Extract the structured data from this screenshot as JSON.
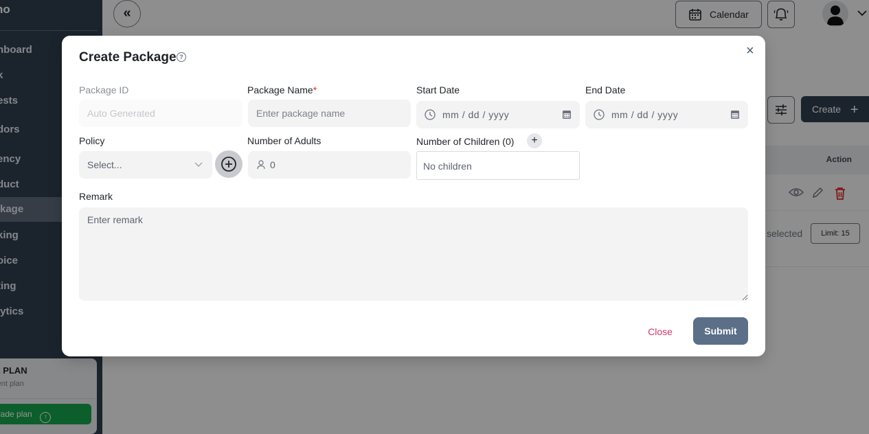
{
  "sidebar": {
    "brand": "no",
    "items": [
      {
        "label": "hboard"
      },
      {
        "label": "k"
      },
      {
        "label": "ests"
      },
      {
        "label": "dors"
      },
      {
        "label": "ency"
      },
      {
        "label": "duct"
      },
      {
        "label": "kage",
        "active": true
      },
      {
        "label": "king"
      },
      {
        "label": "oice"
      },
      {
        "label": "ting"
      },
      {
        "label": "lytics"
      }
    ],
    "plan": {
      "title": "E PLAN",
      "subtitle": "rent plan",
      "upgrade_label": "grade plan"
    }
  },
  "topbar": {
    "calendar_label": "Calendar"
  },
  "page": {
    "create_label": "Create",
    "table_action_header": "Action",
    "selected_text": "selected",
    "limit_label": "Limit: 15"
  },
  "modal": {
    "title": "Create Package",
    "fields": {
      "package_id": {
        "label": "Package ID",
        "placeholder": "Auto Generated"
      },
      "package_name": {
        "label": "Package Name",
        "required_mark": "*",
        "placeholder": "Enter package name"
      },
      "start_date": {
        "label": "Start Date",
        "placeholder": "mm / dd / yyyy"
      },
      "end_date": {
        "label": "End Date",
        "placeholder": "mm / dd / yyyy"
      },
      "policy": {
        "label": "Policy",
        "placeholder": "Select..."
      },
      "adults": {
        "label": "Number of Adults",
        "value": "0"
      },
      "children": {
        "label": "Number of Children (0)",
        "empty_text": "No children"
      },
      "remark": {
        "label": "Remark",
        "placeholder": "Enter remark"
      }
    },
    "close_label": "Close",
    "submit_label": "Submit"
  },
  "colors": {
    "sidebar_bg": "#2f3e4e",
    "submit_bg": "#5b6f89",
    "close_text": "#d1356b",
    "required": "#dc2626",
    "upgrade_green": "#16a34a"
  }
}
